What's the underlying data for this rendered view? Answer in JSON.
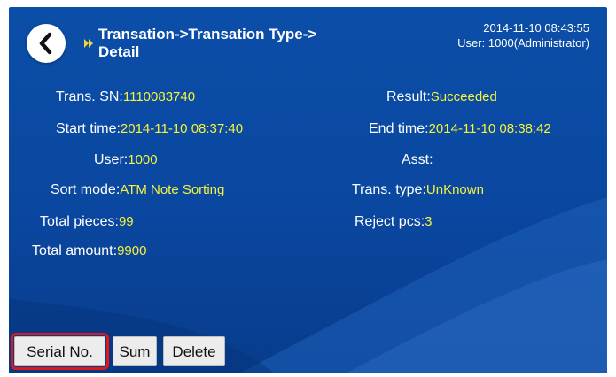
{
  "header": {
    "title_line1": "Transation->Transation Type->",
    "title_line2": "Detail",
    "datetime": "2014-11-10 08:43:55",
    "user": "User: 1000(Administrator)"
  },
  "details": {
    "trans_sn": {
      "label": "Trans. SN:",
      "value": "1110083740"
    },
    "result": {
      "label": "Result:",
      "value": "Succeeded"
    },
    "start_time": {
      "label": "Start time:",
      "value": "2014-11-10 08:37:40"
    },
    "end_time": {
      "label": "End time:",
      "value": "2014-11-10 08:38:42"
    },
    "user": {
      "label": "User:",
      "value": "1000"
    },
    "asst": {
      "label": "Asst:",
      "value": ""
    },
    "sort_mode": {
      "label": "Sort mode:",
      "value": "ATM Note  Sorting"
    },
    "trans_type": {
      "label": "Trans. type:",
      "value": "UnKnown"
    },
    "total_pieces": {
      "label": "Total pieces:",
      "value": "99"
    },
    "reject_pcs": {
      "label": "Reject pcs:",
      "value": "3"
    },
    "total_amount": {
      "label": "Total amount:",
      "value": "9900"
    }
  },
  "buttons": {
    "serial_no": "Serial No.",
    "sum": "Sum",
    "delete": "Delete"
  },
  "colors": {
    "background": "#0a47a0",
    "value_text": "#f6f23c",
    "highlight_border": "#e0161b"
  },
  "icons": {
    "back": "chevron-left-icon",
    "breadcrumb": "double-chevron-right-icon"
  }
}
